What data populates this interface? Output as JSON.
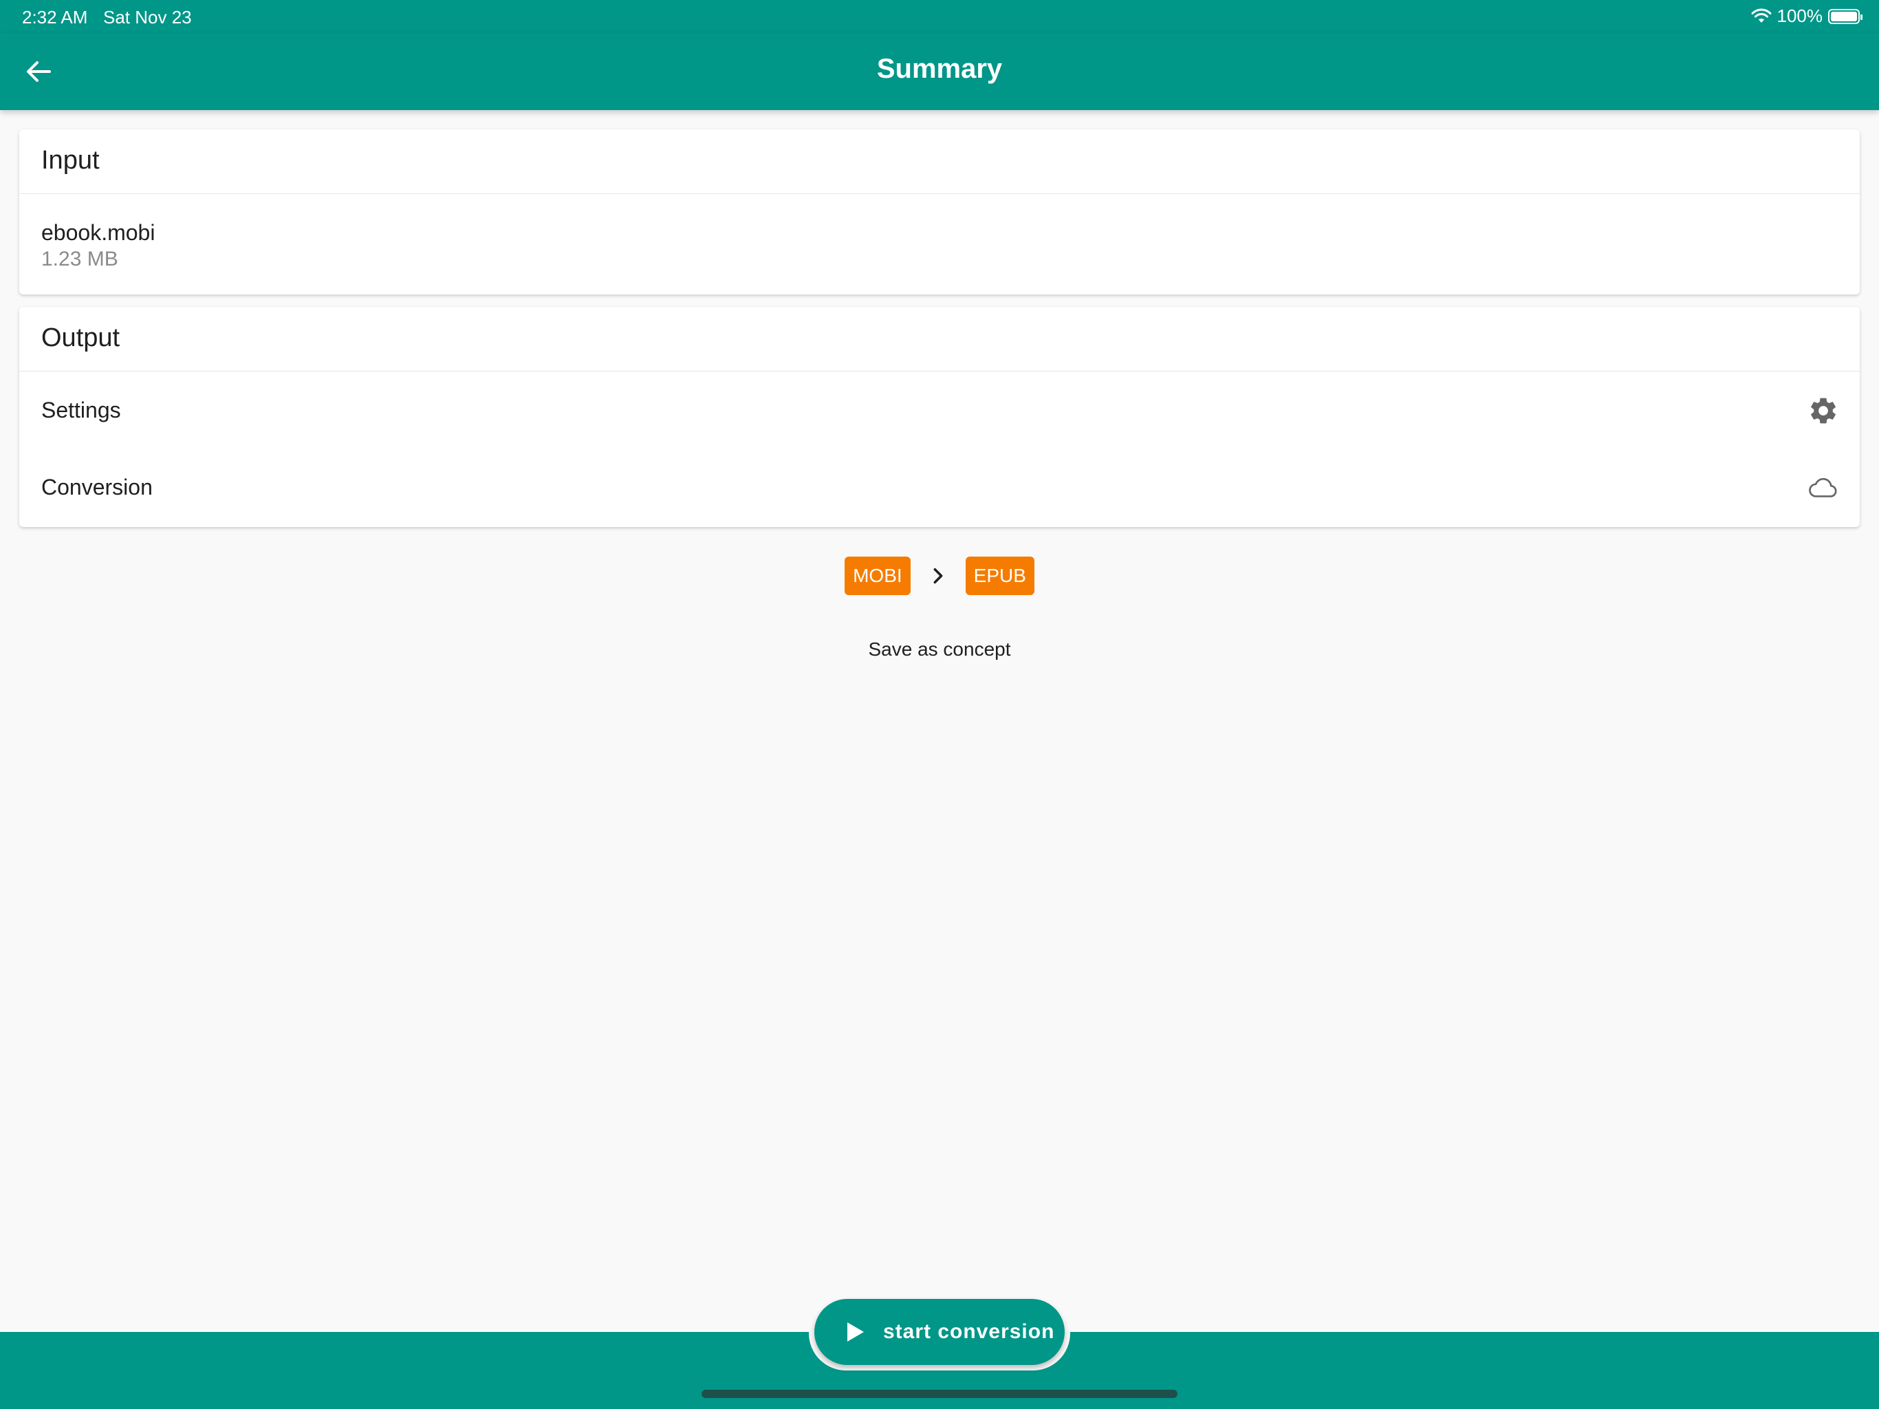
{
  "status_bar": {
    "time": "2:32 AM",
    "date": "Sat Nov 23",
    "battery": "100%"
  },
  "app_bar": {
    "title": "Summary",
    "back_icon": "arrow-left-icon"
  },
  "input_card": {
    "title": "Input",
    "file_name": "ebook.mobi",
    "file_size": "1.23 MB"
  },
  "output_card": {
    "title": "Output",
    "rows": [
      {
        "label": "Settings",
        "icon": "gear-icon"
      },
      {
        "label": "Conversion",
        "icon": "cloud-icon"
      }
    ]
  },
  "formats": {
    "from": "MOBI",
    "to": "EPUB",
    "separator_icon": "chevron-right-icon"
  },
  "save_concept_label": "Save as concept",
  "start_button": {
    "label": "start conversion",
    "icon": "play-icon"
  },
  "colors": {
    "primary": "#009688",
    "accent": "#f57c00",
    "background": "#f9f9f9",
    "card": "#ffffff"
  }
}
